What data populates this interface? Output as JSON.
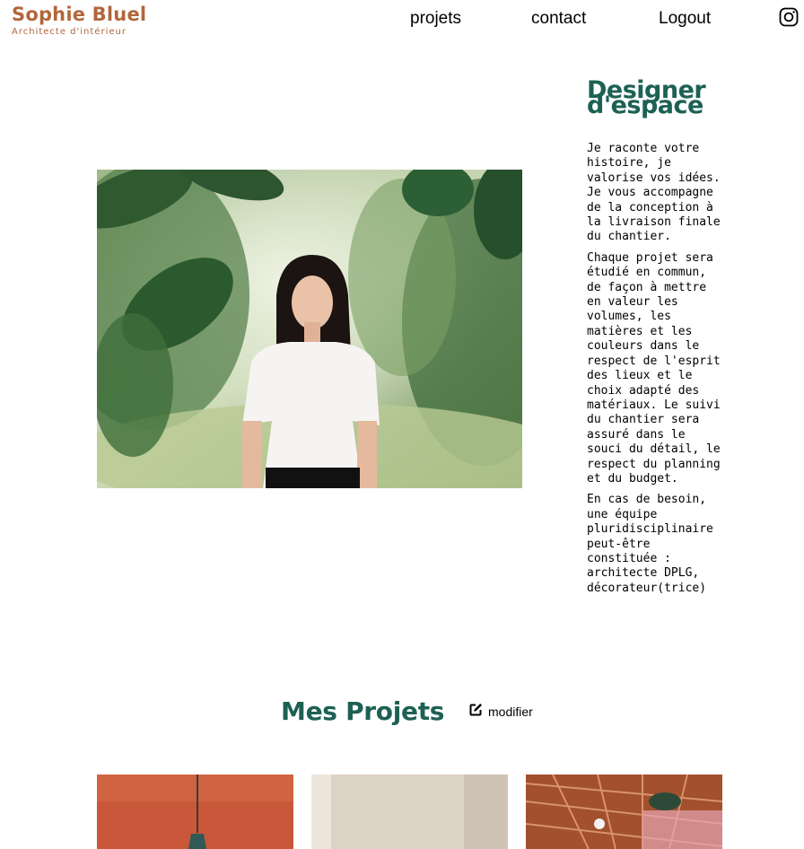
{
  "header": {
    "logo_title": "Sophie Bluel",
    "logo_subtitle": "Architecte d'intérieur",
    "nav": [
      {
        "label": "projets"
      },
      {
        "label": "contact"
      },
      {
        "label": "Logout"
      }
    ],
    "social_icon": "instagram-icon"
  },
  "introduction": {
    "title_line1": "Designer",
    "title_line2": "d'espace",
    "paragraphs": [
      "Je raconte votre histoire, je valorise vos idées. Je vous accompagne de la conception à la livraison finale du chantier.",
      "Chaque projet sera étudié en commun, de façon à mettre en valeur les volumes, les matières et les couleurs dans le respect de l'esprit des lieux et le choix adapté des matériaux. Le suivi du chantier sera assuré dans le souci du détail, le respect du planning et du budget.",
      "En cas de besoin, une équipe pluridisciplinaire peut-être constituée : architecte DPLG, décorateur(trice)"
    ]
  },
  "projects": {
    "title": "Mes Projets",
    "modify_label": "modifier",
    "modify_icon": "edit-icon"
  },
  "colors": {
    "brand": "#B1663C",
    "accent": "#1D6154"
  }
}
